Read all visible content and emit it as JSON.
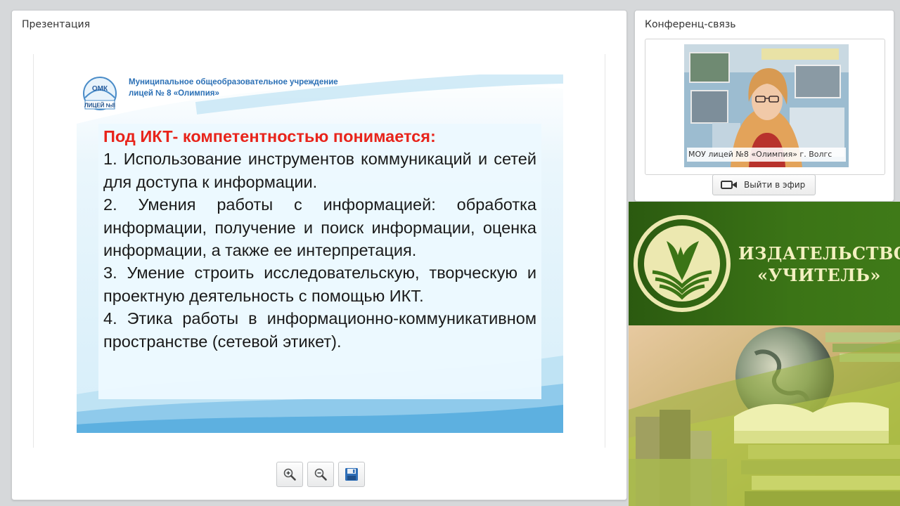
{
  "presentation": {
    "title": "Презентация",
    "slide": {
      "school_line1": "Муниципальное общеобразовательное учреждение",
      "school_line2": "лицей № 8 «Олимпия»",
      "logo_top": "ОМК",
      "logo_bottom": "ЛИЦЕЙ №8",
      "heading": "Под ИКТ- компетентностью понимается:",
      "items": [
        "1. Использование инструментов коммуникаций и сетей для доступа к информации.",
        "2. Умения работы с информацией: обработка информации, получение и поиск информации, оценка информации, а также ее интерпретация.",
        "3. Умение строить исследовательскую, творческую и проектную деятельность с помощью ИКТ.",
        "4. Этика работы в информационно-коммуникативном пространстве (сетевой этикет)."
      ]
    },
    "toolbar": {
      "zoom_in_icon": "zoom-in-icon",
      "zoom_out_icon": "zoom-out-icon",
      "save_icon": "floppy-disk-icon"
    }
  },
  "conference": {
    "title": "Конференц-связь",
    "video_label": "МОУ лицей №8 «Олимпия» г. Волгс",
    "go_live_label": "Выйти в эфир",
    "go_live_icon": "camera-icon"
  },
  "publisher": {
    "name_line1": "ИЗДАТЕЛЬСТВО",
    "name_line2": "«УЧИТЕЛЬ»"
  },
  "colors": {
    "heading_red": "#e8241b",
    "school_blue": "#2a6fb5",
    "banner_green": "#3b7416",
    "banner_text": "#f3f0c0"
  }
}
